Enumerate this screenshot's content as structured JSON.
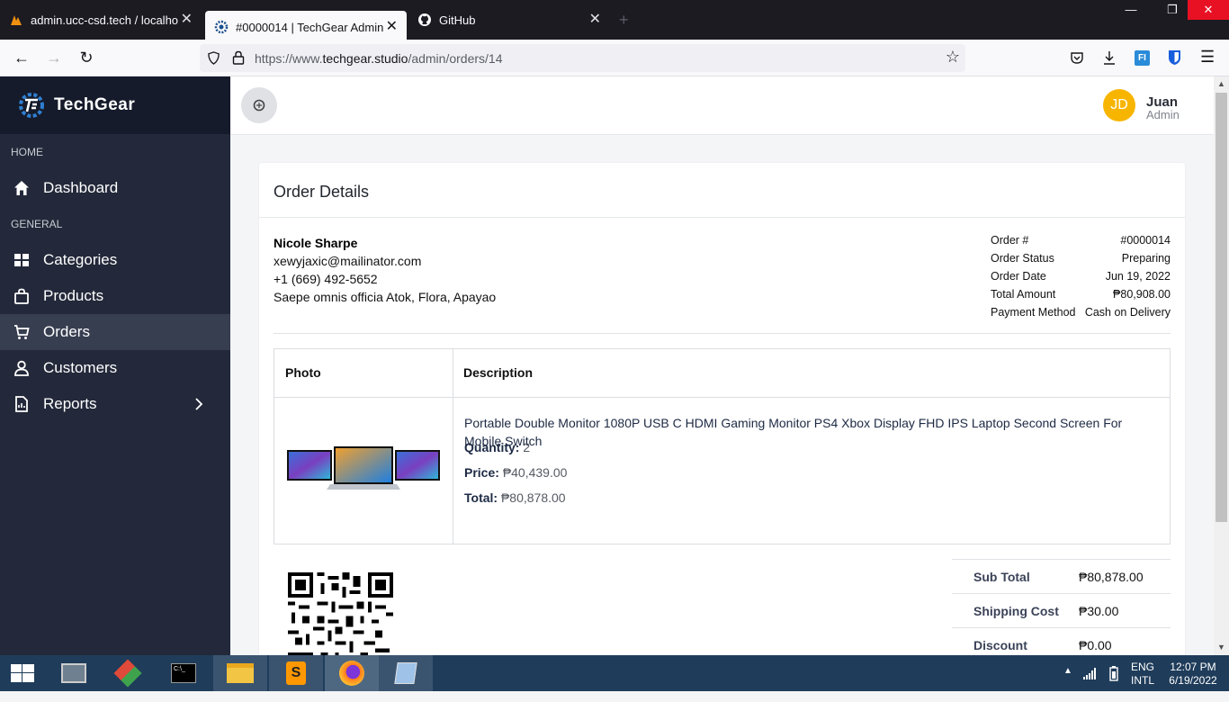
{
  "browser": {
    "tabs": [
      {
        "title": "admin.ucc-csd.tech / localhost",
        "active": false
      },
      {
        "title": "#0000014 | TechGear Admin",
        "active": true
      },
      {
        "title": "GitHub",
        "active": false
      }
    ],
    "url_prefix": "https://www.",
    "url_host": "techgear.studio",
    "url_path": "/admin/orders/14"
  },
  "sidebar": {
    "brand": "TechGear",
    "sections": [
      {
        "label": "HOME"
      },
      {
        "label": "GENERAL"
      }
    ],
    "items": [
      {
        "label": "Dashboard",
        "icon": "home-icon"
      },
      {
        "label": "Categories",
        "icon": "grid-icon"
      },
      {
        "label": "Products",
        "icon": "bag-icon"
      },
      {
        "label": "Orders",
        "icon": "cart-icon",
        "active": true
      },
      {
        "label": "Customers",
        "icon": "user-icon"
      },
      {
        "label": "Reports",
        "icon": "report-icon"
      }
    ]
  },
  "topbar": {
    "avatar_initials": "JD",
    "user_name": "Juan",
    "user_role": "Admin"
  },
  "order": {
    "title": "Order Details",
    "customer": {
      "name": "Nicole Sharpe",
      "email": "xewyjaxic@mailinator.com",
      "phone": "+1 (669) 492-5652",
      "address": "Saepe omnis officia Atok, Flora, Apayao"
    },
    "meta": [
      {
        "label": "Order #",
        "value": "#0000014"
      },
      {
        "label": "Order Status",
        "value": "Preparing"
      },
      {
        "label": "Order Date",
        "value": "Jun 19, 2022"
      },
      {
        "label": "Total Amount",
        "value": "₱80,908.00"
      },
      {
        "label": "Payment Method",
        "value": "Cash on Delivery"
      }
    ],
    "table_headers": {
      "photo": "Photo",
      "description": "Description"
    },
    "item": {
      "name": "Portable Double Monitor 1080P USB C HDMI Gaming Monitor PS4 Xbox Display FHD IPS Laptop Second Screen For Mobile Switch",
      "quantity_label": "Quantity:",
      "quantity": "2",
      "price_label": "Price:",
      "price": "₱40,439.00",
      "total_label": "Total:",
      "total": "₱80,878.00"
    },
    "summary": [
      {
        "label": "Sub Total",
        "value": "₱80,878.00"
      },
      {
        "label": "Shipping Cost",
        "value": "₱30.00"
      },
      {
        "label": "Discount",
        "value": "₱0.00"
      }
    ]
  },
  "taskbar": {
    "lang_top": "ENG",
    "lang_bottom": "INTL",
    "time": "12:07 PM",
    "date": "6/19/2022"
  },
  "colors": {
    "sidebar_bg": "#23293a",
    "brand_bg": "#151b2b",
    "active_item": "#373e50",
    "avatar": "#f7b500"
  }
}
